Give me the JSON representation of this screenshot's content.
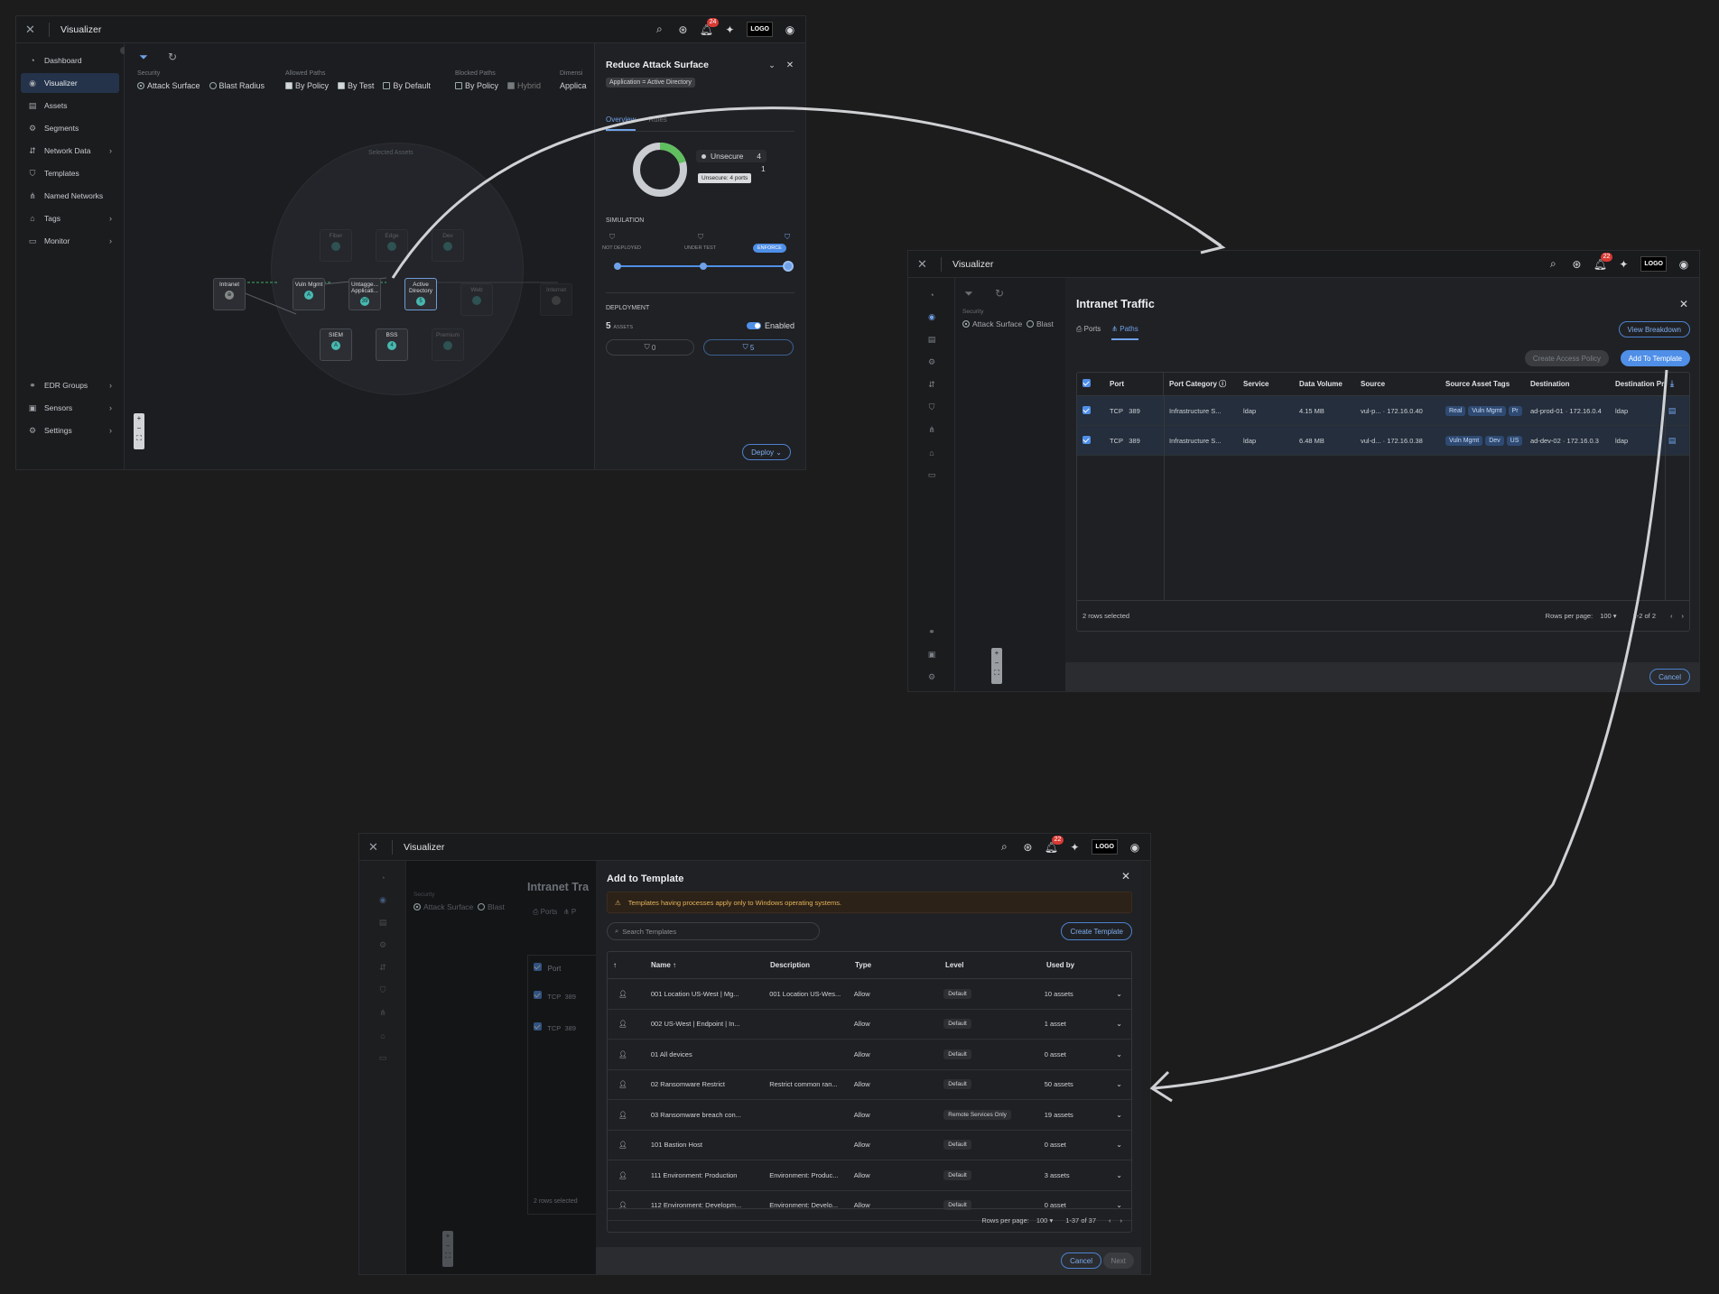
{
  "app": {
    "title": "Visualizer",
    "notif1": "24",
    "notif2": "22",
    "notif3": "22",
    "logo": "LOGO"
  },
  "sidebar": {
    "items": [
      {
        "label": "Dashboard",
        "icon": "dashboard-icon",
        "chev": false
      },
      {
        "label": "Visualizer",
        "icon": "eye-icon",
        "chev": false,
        "active": true
      },
      {
        "label": "Assets",
        "icon": "assets-icon",
        "chev": false
      },
      {
        "label": "Segments",
        "icon": "segments-icon",
        "chev": false
      },
      {
        "label": "Network Data",
        "icon": "network-data-icon",
        "chev": true
      },
      {
        "label": "Templates",
        "icon": "shield-icon",
        "chev": false
      },
      {
        "label": "Named Networks",
        "icon": "named-networks-icon",
        "chev": false
      },
      {
        "label": "Tags",
        "icon": "tag-icon",
        "chev": true
      },
      {
        "label": "Monitor",
        "icon": "monitor-icon",
        "chev": true
      }
    ],
    "bottom": [
      {
        "label": "EDR Groups",
        "icon": "edr-icon"
      },
      {
        "label": "Sensors",
        "icon": "sensors-icon"
      },
      {
        "label": "Settings",
        "icon": "gear-icon"
      }
    ]
  },
  "filters": {
    "security": {
      "label": "Security",
      "opts": [
        "Attack Surface",
        "Blast Radius"
      ]
    },
    "allowed": {
      "label": "Allowed Paths",
      "opts": [
        "By Policy",
        "By Test",
        "By Default"
      ]
    },
    "blocked": {
      "label": "Blocked Paths",
      "opts": [
        "By Policy",
        "Hybrid"
      ]
    },
    "dimension": {
      "label": "Dimensi",
      "value": "Applica"
    }
  },
  "graph": {
    "selected_label": "Selected Assets",
    "nodes": [
      {
        "label": "Intranet",
        "count": ""
      },
      {
        "label": "Vuln Mgmt",
        "count": "A"
      },
      {
        "label": "Untagge... Applicati...",
        "count": "39"
      },
      {
        "label": "Active Directory",
        "count": "5"
      },
      {
        "label": "SIEM",
        "count": "A"
      },
      {
        "label": "BSS",
        "count": "4"
      },
      {
        "label": "Fiber",
        "count": ""
      },
      {
        "label": "Edge",
        "count": ""
      },
      {
        "label": "Dev",
        "count": ""
      },
      {
        "label": "Web",
        "count": ""
      },
      {
        "label": "Internet",
        "count": ""
      },
      {
        "label": "Premium",
        "count": ""
      }
    ]
  },
  "reduce": {
    "title": "Reduce Attack Surface",
    "chip": "Application = Active Directory",
    "tabs": [
      "Overview",
      "Rules"
    ],
    "donut": {
      "legend": "Unsecure",
      "value": "4",
      "second": "1",
      "tooltip": "Unsecure: 4 ports",
      "secure_fraction": 0.2
    },
    "simulation": {
      "label": "SIMULATION",
      "steps": [
        "NOT DEPLOYED",
        "UNDER TEST",
        "ENFORCE"
      ],
      "position": 1.0
    },
    "deployment": {
      "label": "DEPLOYMENT",
      "count": "5",
      "unit": "ASSETS",
      "toggle": "Enabled",
      "box1": "0",
      "box2": "5"
    },
    "deploy_btn": "Deploy"
  },
  "intranet": {
    "title": "Intranet Traffic",
    "tabs": [
      "Ports",
      "Paths"
    ],
    "view_btn": "View Breakdown",
    "create_btn": "Create Access Policy",
    "add_btn": "Add To Template",
    "columns": [
      "Port",
      "Port Category",
      "Service",
      "Data Volume",
      "Source",
      "Source Asset Tags",
      "Destination",
      "Destination Pr"
    ],
    "rows": [
      {
        "proto": "TCP",
        "port": "389",
        "cat": "Infrastructure S...",
        "svc": "ldap",
        "vol": "4.15 MB",
        "src": "vul-p...",
        "srcip": "172.16.0.40",
        "tags": [
          "Real",
          "Vuln Mgmt",
          "Pr"
        ],
        "dst": "ad-prod-01",
        "dstip": "172.16.0.4",
        "dp": "ldap"
      },
      {
        "proto": "TCP",
        "port": "389",
        "cat": "Infrastructure S...",
        "svc": "ldap",
        "vol": "6.48 MB",
        "src": "vul-d...",
        "srcip": "172.16.0.38",
        "tags": [
          "Vuln Mgmt",
          "Dev",
          "US"
        ],
        "dst": "ad-dev-02",
        "dstip": "172.16.0.3",
        "dp": "ldap"
      }
    ],
    "footer": {
      "selected": "2 rows selected",
      "rpp_label": "Rows per page:",
      "rpp": "100",
      "range": "1-2 of 2"
    },
    "cancel": "Cancel",
    "sec": "Security",
    "sec_opts": [
      "Attack Surface",
      "Blast"
    ]
  },
  "template": {
    "title": "Add to Template",
    "warning": "Templates having processes apply only to Windows operating systems.",
    "search_placeholder": "Search Templates",
    "create_btn": "Create Template",
    "columns": [
      "Name",
      "Description",
      "Type",
      "Level",
      "Used by"
    ],
    "rows": [
      {
        "name": "001 Location US-West | Mg...",
        "desc": "001 Location US-Wes...",
        "type": "Allow",
        "level": "Default",
        "used": "10 assets"
      },
      {
        "name": "002 US-West | Endpoint | In...",
        "desc": "",
        "type": "Allow",
        "level": "Default",
        "used": "1 asset"
      },
      {
        "name": "01 All devices",
        "desc": "",
        "type": "Allow",
        "level": "Default",
        "used": "0 asset"
      },
      {
        "name": "02 Ransomware Restrict",
        "desc": "Restrict common ran...",
        "type": "Allow",
        "level": "Default",
        "used": "50 assets"
      },
      {
        "name": "03 Ransomware breach con...",
        "desc": "",
        "type": "Allow",
        "level": "Remote Services Only",
        "used": "19 assets"
      },
      {
        "name": "101 Bastion Host",
        "desc": "",
        "type": "Allow",
        "level": "Default",
        "used": "0 asset"
      },
      {
        "name": "111 Environment: Production",
        "desc": "Environment: Produc...",
        "type": "Allow",
        "level": "Default",
        "used": "3 assets"
      },
      {
        "name": "112 Environment: Developm...",
        "desc": "Environment: Develo...",
        "type": "Allow",
        "level": "Default",
        "used": "0 asset"
      }
    ],
    "footer": {
      "rpp_label": "Rows per page:",
      "rpp": "100",
      "range": "1-37 of 37"
    },
    "cancel": "Cancel",
    "next": "Next",
    "bg_title": "Intranet Tra",
    "bg_port": "Port",
    "bg_proto": "TCP",
    "bg_num": "389",
    "bg_selected": "2 rows selected"
  }
}
